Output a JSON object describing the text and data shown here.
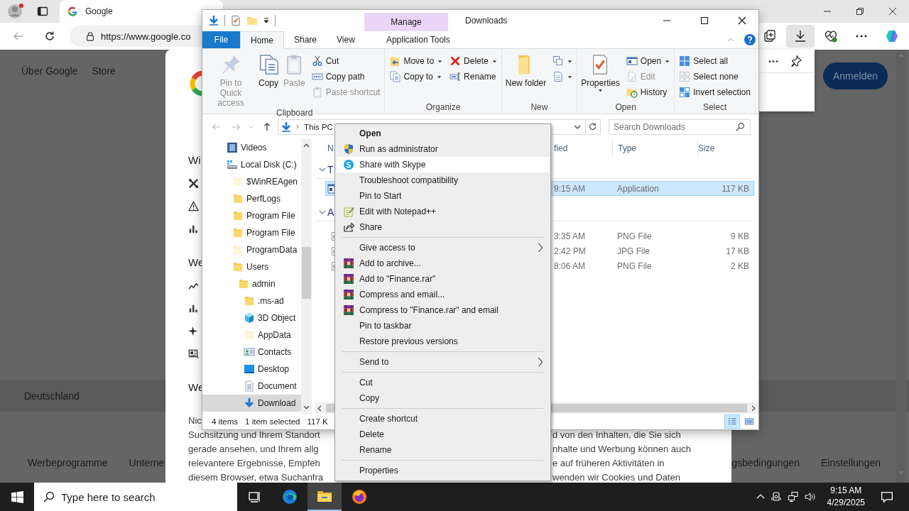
{
  "browser": {
    "tab": {
      "title": "Google",
      "selected": true
    },
    "address": "https://www.google.co",
    "toolbar_buttons": [
      {
        "kind": "collections",
        "selected": false
      },
      {
        "kind": "downloads",
        "selected": true
      },
      {
        "kind": "health",
        "selected": false
      },
      {
        "kind": "more",
        "selected": false
      },
      {
        "kind": "copilot",
        "selected": false
      }
    ],
    "page": {
      "nav_links": [
        "Über Google",
        "Store"
      ],
      "sign_in": "Anmelden",
      "country": "Deutschland",
      "footer_left": [
        "Werbeprogramme",
        "Unterne"
      ],
      "footer_right": [
        "gsbedingungen",
        "Einstellungen"
      ],
      "dialog": {
        "sections": [
          {
            "heading": "Wi",
            "items": [
              {
                "kind": "tools"
              },
              {
                "kind": "warning"
              },
              {
                "kind": "bars"
              }
            ]
          },
          {
            "heading": "We",
            "items": [
              {
                "kind": "trend"
              },
              {
                "kind": "bars"
              },
              {
                "kind": "sparkle"
              },
              {
                "kind": "news"
              }
            ]
          },
          {
            "heading": "We"
          }
        ],
        "lines": [
          {
            "left": "Nic"
          },
          {
            "left": "Suchsitzung und Ihrem Standort",
            "right": "d von den Inhalten, die Sie sich"
          },
          {
            "left": "gerade ansehen, und Ihrem allg",
            "right": "nhalte und Werbung können auch"
          },
          {
            "left": "relevantere Ergebnisse, Empfeh",
            "right": "e auf früheren Aktivitäten in"
          },
          {
            "left": "diesem Browser, etwa Suchanfra",
            "right": "wenden wir Cookies und Daten"
          }
        ]
      }
    }
  },
  "explorer": {
    "title": "Downloads",
    "context_tab": "Manage",
    "tabs": [
      {
        "label": "File",
        "kind": "file",
        "selected": false
      },
      {
        "label": "Home",
        "kind": "tab",
        "selected": true
      },
      {
        "label": "Share",
        "kind": "tab",
        "selected": false
      },
      {
        "label": "View",
        "kind": "tab",
        "selected": false
      },
      {
        "label": "Application Tools",
        "kind": "context",
        "selected": false
      }
    ],
    "ribbon": [
      {
        "label": "Clipboard",
        "columns": [
          {
            "kind": "large",
            "commands": [
              {
                "label": "Pin to Quick access",
                "kind": "pin",
                "disabled": true
              },
              {
                "label": "Copy",
                "kind": "copy",
                "disabled": false
              },
              {
                "label": "Paste",
                "kind": "paste",
                "disabled": true
              }
            ]
          },
          {
            "kind": "small",
            "commands": [
              {
                "label": "Cut",
                "kind": "cut",
                "disabled": false
              },
              {
                "label": "Copy path",
                "kind": "copypath",
                "disabled": false
              },
              {
                "label": "Paste shortcut",
                "kind": "pasteshortcut",
                "disabled": true
              }
            ]
          }
        ]
      },
      {
        "label": "Organize",
        "columns": [
          {
            "kind": "small",
            "commands": [
              {
                "label": "Move to",
                "kind": "moveto",
                "disabled": false,
                "dropdown": true
              },
              {
                "label": "Copy to",
                "kind": "copyto",
                "disabled": false,
                "dropdown": true
              }
            ]
          },
          {
            "kind": "small",
            "commands": [
              {
                "label": "Delete",
                "kind": "delete",
                "disabled": false,
                "dropdown": true
              },
              {
                "label": "Rename",
                "kind": "rename",
                "disabled": false
              }
            ]
          }
        ]
      },
      {
        "label": "New",
        "columns": [
          {
            "kind": "large",
            "commands": [
              {
                "label": "New folder",
                "kind": "newfolder",
                "disabled": false
              }
            ]
          },
          {
            "kind": "small",
            "commands": [
              {
                "kind": "newitem",
                "disabled": false,
                "dropdown": true
              },
              {
                "kind": "easyaccess",
                "disabled": false,
                "dropdown": true
              }
            ]
          }
        ]
      },
      {
        "label": "Open",
        "columns": [
          {
            "kind": "large",
            "commands": [
              {
                "label": "Properties",
                "kind": "properties",
                "disabled": false,
                "dropdown": true
              }
            ]
          },
          {
            "kind": "small",
            "commands": [
              {
                "label": "Open",
                "kind": "open",
                "disabled": false,
                "dropdown": true
              },
              {
                "label": "Edit",
                "kind": "edit",
                "disabled": true
              },
              {
                "label": "History",
                "kind": "history",
                "disabled": false
              }
            ]
          }
        ]
      },
      {
        "label": "Select",
        "columns": [
          {
            "kind": "small",
            "commands": [
              {
                "label": "Select all",
                "kind": "selectall",
                "disabled": false
              },
              {
                "label": "Select none",
                "kind": "selectnone",
                "disabled": false
              },
              {
                "label": "Invert selection",
                "kind": "invert",
                "disabled": false
              }
            ]
          }
        ]
      }
    ],
    "address": "This PC",
    "search_placeholder": "Search Downloads",
    "nav_tree": [
      {
        "label": "Videos",
        "kind": "videos",
        "selected": false
      },
      {
        "label": "Local Disk (C:)",
        "kind": "drive",
        "selected": false,
        "children": [
          {
            "label": "$WinREAgen",
            "kind": "pale",
            "selected": false
          },
          {
            "label": "PerfLogs",
            "kind": "folder",
            "selected": false
          },
          {
            "label": "Program File",
            "kind": "folder",
            "selected": false
          },
          {
            "label": "Program File",
            "kind": "folder",
            "selected": false
          },
          {
            "label": "ProgramData",
            "kind": "pale",
            "selected": false
          },
          {
            "label": "Users",
            "kind": "folder",
            "selected": false,
            "children": [
              {
                "label": "admin",
                "kind": "folder",
                "selected": false,
                "children": [
                  {
                    "label": ".ms-ad",
                    "kind": "folder",
                    "selected": false
                  },
                  {
                    "label": "3D Object",
                    "kind": "cube",
                    "selected": false
                  },
                  {
                    "label": "AppData",
                    "kind": "pale",
                    "selected": false
                  },
                  {
                    "label": "Contacts",
                    "kind": "contacts",
                    "selected": false
                  },
                  {
                    "label": "Desktop",
                    "kind": "desktop",
                    "selected": false
                  },
                  {
                    "label": "Document",
                    "kind": "documents",
                    "selected": false
                  },
                  {
                    "label": "Download",
                    "kind": "downloads",
                    "selected": true
                  }
                ]
              }
            ]
          }
        ]
      }
    ],
    "columns": [
      "N",
      "fied",
      "Type",
      "Size"
    ],
    "groups": [
      {
        "label": "T",
        "expanded": true,
        "rows": [
          {
            "kind": "app",
            "modified": "9:15 AM",
            "type": "Application",
            "size": "117 KB",
            "selected": true
          }
        ]
      },
      {
        "label": "A",
        "expanded": true,
        "rows": [
          {
            "kind": "image",
            "modified": "3:35 AM",
            "type": "PNG File",
            "size": "9 KB",
            "selected": false
          },
          {
            "kind": "image",
            "modified": "2:42 PM",
            "type": "JPG File",
            "size": "17 KB",
            "selected": false
          },
          {
            "kind": "image",
            "modified": "8:06 AM",
            "type": "PNG File",
            "size": "2 KB",
            "selected": false
          }
        ]
      }
    ],
    "status": [
      "4 items",
      "1 item selected",
      "117 K"
    ]
  },
  "context_menu": [
    {
      "label": "Open",
      "kind": "default",
      "submenu": false,
      "selected": false
    },
    {
      "label": "Run as administrator",
      "kind": "shield",
      "submenu": false,
      "selected": false
    },
    {
      "label": "Share with Skype",
      "kind": "skype",
      "submenu": false,
      "selected": true
    },
    {
      "label": "Troubleshoot compatibility",
      "kind": "plain",
      "submenu": false,
      "selected": false
    },
    {
      "label": "Pin to Start",
      "kind": "plain",
      "submenu": false,
      "selected": false
    },
    {
      "label": "Edit with Notepad++",
      "kind": "notepad",
      "submenu": false,
      "selected": false
    },
    {
      "label": "Share",
      "kind": "share",
      "submenu": false,
      "selected": false
    },
    {
      "kind": "separator"
    },
    {
      "label": "Give access to",
      "kind": "plain",
      "submenu": true,
      "selected": false
    },
    {
      "label": "Add to archive...",
      "kind": "archive",
      "submenu": false,
      "selected": false
    },
    {
      "label": "Add to \"Finance.rar\"",
      "kind": "archive",
      "submenu": false,
      "selected": false
    },
    {
      "label": "Compress and email...",
      "kind": "archive",
      "submenu": false,
      "selected": false
    },
    {
      "label": "Compress to \"Finance.rar\" and email",
      "kind": "archive",
      "submenu": false,
      "selected": false
    },
    {
      "label": "Pin to taskbar",
      "kind": "plain",
      "submenu": false,
      "selected": false
    },
    {
      "label": "Restore previous versions",
      "kind": "plain",
      "submenu": false,
      "selected": false
    },
    {
      "kind": "separator"
    },
    {
      "label": "Send to",
      "kind": "plain",
      "submenu": true,
      "selected": false
    },
    {
      "kind": "separator"
    },
    {
      "label": "Cut",
      "kind": "plain",
      "submenu": false,
      "selected": false
    },
    {
      "label": "Copy",
      "kind": "plain",
      "submenu": false,
      "selected": false
    },
    {
      "kind": "separator"
    },
    {
      "label": "Create shortcut",
      "kind": "plain",
      "submenu": false,
      "selected": false
    },
    {
      "label": "Delete",
      "kind": "plain",
      "submenu": false,
      "selected": false
    },
    {
      "label": "Rename",
      "kind": "plain",
      "submenu": false,
      "selected": false
    },
    {
      "kind": "separator"
    },
    {
      "label": "Properties",
      "kind": "plain",
      "submenu": false,
      "selected": false
    }
  ],
  "taskbar": {
    "search_placeholder": "Type here to search",
    "apps": [
      {
        "kind": "taskview",
        "selected": false
      },
      {
        "kind": "edge",
        "selected": false
      },
      {
        "kind": "explorer",
        "selected": true
      },
      {
        "kind": "firefox",
        "selected": false
      }
    ],
    "time": "9:15 AM",
    "date": "4/29/2025"
  }
}
